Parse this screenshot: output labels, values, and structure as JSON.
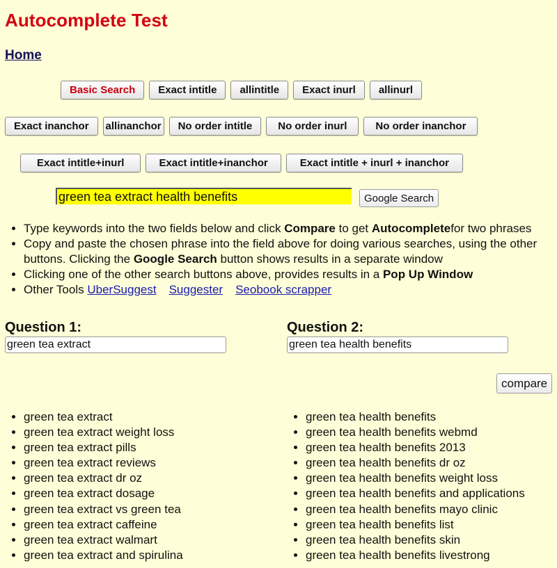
{
  "page": {
    "title": "Autocomplete Test",
    "home_link": "Home"
  },
  "colors": {
    "background": "#fefed8",
    "title": "#d40010",
    "search_highlight": "#ffff00",
    "link": "#1a1ab0"
  },
  "search_buttons": {
    "row1": [
      {
        "label": "Basic Search",
        "active": true
      },
      {
        "label": "Exact intitle"
      },
      {
        "label": "allintitle"
      },
      {
        "label": "Exact inurl"
      },
      {
        "label": "allinurl"
      }
    ],
    "row2": [
      {
        "label": "Exact inanchor"
      },
      {
        "label": "allinanchor"
      },
      {
        "label": "No order intitle"
      },
      {
        "label": "No order inurl"
      },
      {
        "label": "No order inanchor"
      }
    ],
    "row3": [
      {
        "label": "Exact intitle+inurl"
      },
      {
        "label": "Exact intitle+inanchor"
      },
      {
        "label": "Exact intitle + inurl + inanchor"
      }
    ]
  },
  "search": {
    "value": "green tea extract health benefits",
    "google_button": "Google Search"
  },
  "instructions": {
    "item1": {
      "t1": "Type keywords into the two fields below and click ",
      "b1": "Compare",
      "t2": " to get ",
      "b2": "Autocomplete",
      "t3": "for two phrases"
    },
    "item2": {
      "t1": "Copy and paste the chosen phrase into the field above for doing various searches, using the other buttons. Clicking the ",
      "b1": "Google Search",
      "t2": " button shows results in a separate window"
    },
    "item3": {
      "t1": "Clicking one of the other search buttons above, provides results in a ",
      "b1": "Pop Up Window"
    },
    "item4": {
      "t1": "Other Tools ",
      "links": [
        "UberSuggest",
        "Suggester",
        "Seobook scrapper"
      ]
    }
  },
  "questions": {
    "q1": {
      "label": "Question 1:",
      "value": "green tea extract"
    },
    "q2": {
      "label": "Question 2:",
      "value": "green tea health benefits"
    },
    "compare_button": "compare"
  },
  "results": {
    "q1": [
      "green tea extract",
      "green tea extract weight loss",
      "green tea extract pills",
      "green tea extract reviews",
      "green tea extract dr oz",
      "green tea extract dosage",
      "green tea extract vs green tea",
      "green tea extract caffeine",
      "green tea extract walmart",
      "green tea extract and spirulina"
    ],
    "q2": [
      "green tea health benefits",
      "green tea health benefits webmd",
      "green tea health benefits 2013",
      "green tea health benefits dr oz",
      "green tea health benefits weight loss",
      "green tea health benefits and applications",
      "green tea health benefits mayo clinic",
      "green tea health benefits list",
      "green tea health benefits skin",
      "green tea health benefits livestrong"
    ]
  }
}
